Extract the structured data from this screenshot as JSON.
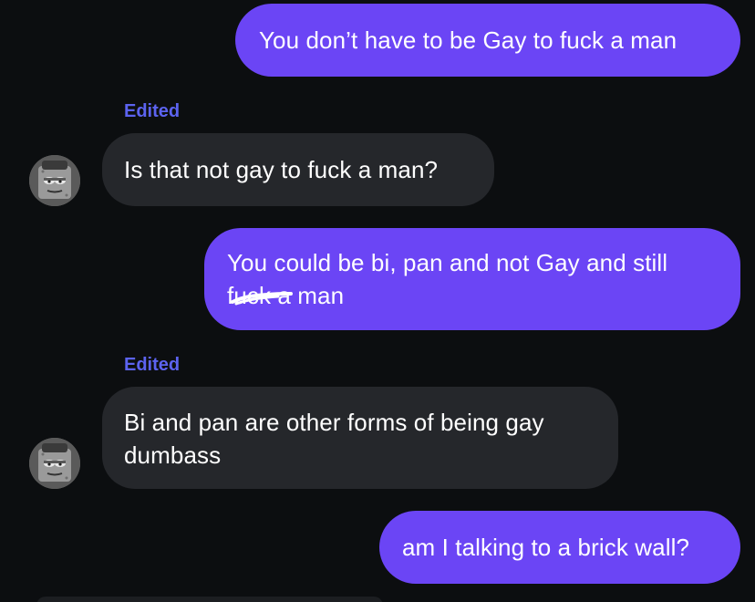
{
  "messages": [
    {
      "direction": "sent",
      "text": "You don’t have to be Gay to fuck a man"
    },
    {
      "direction": "received",
      "edited_label": "Edited",
      "text": "Is that not gay to fuck a man?"
    },
    {
      "direction": "sent",
      "line1": "You could be bi, pan and not Gay and still",
      "line2_prefix": "fuck",
      "line2_rest": " a man"
    },
    {
      "direction": "received",
      "edited_label": "Edited",
      "line1": "Bi and pan are other forms of being gay",
      "line2": "dumbass"
    },
    {
      "direction": "sent",
      "text": "am I talking to a brick wall?"
    }
  ],
  "colors": {
    "background": "#0c0e10",
    "sent_bubble": "#6b45f5",
    "received_bubble": "#25272b",
    "edited_label": "#5c63f0",
    "text": "#ffffff"
  },
  "icons": {
    "avatar": "sponge-character-avatar-icon",
    "scribble": "scribble-redaction-mark"
  }
}
